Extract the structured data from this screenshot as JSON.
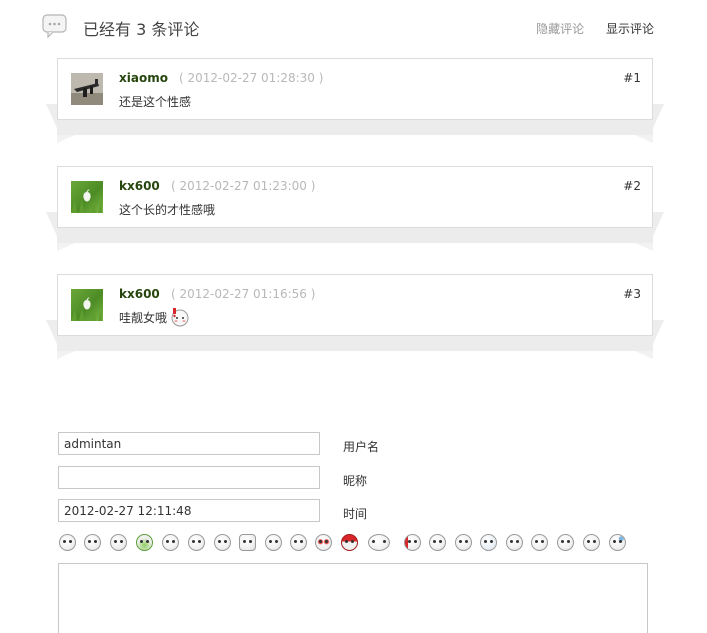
{
  "header": {
    "title": "已经有 3 条评论",
    "hide_label": "隐藏评论",
    "show_label": "显示评论"
  },
  "comments": [
    {
      "author": "xiaomo",
      "date": "( 2012-02-27 01:28:30 )",
      "floor": "#1",
      "content": "还是这个性感",
      "avatar": "gun-avatar"
    },
    {
      "author": "kx600",
      "date": "( 2012-02-27 01:23:00 )",
      "floor": "#2",
      "content": "这个长的才性感哦",
      "avatar": "apple-grass-avatar"
    },
    {
      "author": "kx600",
      "date": "( 2012-02-27 01:16:56 )",
      "floor": "#3",
      "content": "哇靓女哦",
      "avatar": "apple-grass-avatar",
      "emoticon": "blushing-smiley-icon"
    }
  ],
  "form": {
    "username_value": "admintan",
    "username_label": "用户名",
    "nickname_value": "",
    "nickname_label": "昵称",
    "time_value": "2012-02-27 12:11:48",
    "time_label": "时间"
  },
  "smiley_icons": [
    "wink-smiley-icon",
    "smile-smiley-icon",
    "devil-smiley-icon",
    "money-smiley-icon",
    "neutral-smiley-icon",
    "grimace-smiley-icon",
    "shock-smiley-icon",
    "thumbs-up-icon",
    "squint-smiley-icon",
    "sleepy-smiley-icon",
    "love-smiley-icon",
    "angry-red-smiley-icon",
    "angel-smiley-icon",
    "exclaim-smiley-icon",
    "laugh-smiley-icon",
    "surprised-smiley-icon",
    "crying-smiley-icon",
    "glasses-smiley-icon",
    "cool-smiley-icon",
    "smirk-smiley-icon",
    "sweat-smiley-icon",
    "drop-smiley-icon"
  ],
  "colors": {
    "author": "#26460e",
    "date": "#b8b8b8",
    "border": "#dcdcdc"
  }
}
